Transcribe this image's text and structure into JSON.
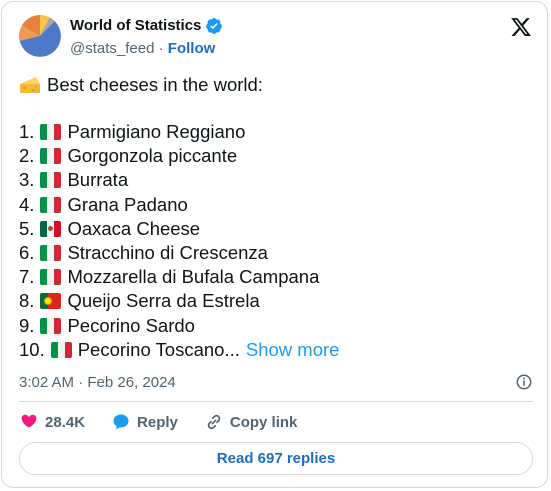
{
  "author": {
    "name": "World of Statistics",
    "handle": "@stats_feed",
    "separator": "·",
    "follow_label": "Follow",
    "verified_icon": "verified-badge-icon"
  },
  "post": {
    "headline_icon": "cheese-wedge-emoji",
    "headline": "Best cheeses in the world:",
    "items": [
      {
        "num": "1.",
        "flag": "italy",
        "name": "Parmigiano Reggiano"
      },
      {
        "num": "2.",
        "flag": "italy",
        "name": "Gorgonzola piccante"
      },
      {
        "num": "3.",
        "flag": "italy",
        "name": "Burrata"
      },
      {
        "num": "4.",
        "flag": "italy",
        "name": "Grana Padano"
      },
      {
        "num": "5.",
        "flag": "mexico",
        "name": "Oaxaca Cheese"
      },
      {
        "num": "6.",
        "flag": "italy",
        "name": "Stracchino di Crescenza"
      },
      {
        "num": "7.",
        "flag": "italy",
        "name": "Mozzarella di Bufala Campana"
      },
      {
        "num": "8.",
        "flag": "portugal",
        "name": "Queijo Serra da Estrela"
      },
      {
        "num": "9.",
        "flag": "italy",
        "name": "Pecorino Sardo"
      },
      {
        "num": "10.",
        "flag": "italy",
        "name": "Pecorino Toscano..."
      }
    ],
    "show_more_label": "Show more",
    "timestamp": "3:02 AM · Feb 26, 2024"
  },
  "actions": {
    "likes": "28.4K",
    "reply_label": "Reply",
    "copy_link_label": "Copy link"
  },
  "footer": {
    "read_replies_label": "Read 697 replies"
  },
  "colors": {
    "link_blue": "#1d9bf0",
    "follow_blue": "#1d6fb8",
    "like_pink": "#f91880",
    "reply_blue": "#1d9bf0",
    "muted_text": "#536471",
    "border": "#cfd9de"
  }
}
